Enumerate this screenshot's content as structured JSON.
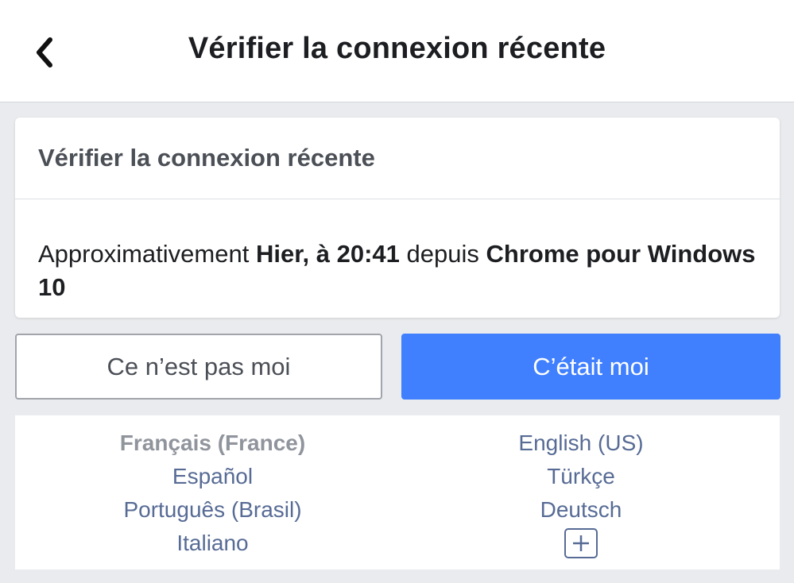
{
  "header": {
    "title": "Vérifier la connexion récente",
    "back_icon": "chevron-left-icon"
  },
  "card": {
    "title": "Vérifier la connexion récente",
    "message": {
      "prefix": "Approximativement ",
      "time": "Hier, à 20:41",
      "middle": " depuis ",
      "device": "Chrome pour Windows 10"
    }
  },
  "actions": {
    "not_me": "Ce n’est pas moi",
    "was_me": "C’était moi"
  },
  "languages": {
    "left": [
      "Français (France)",
      "Español",
      "Português (Brasil)",
      "Italiano"
    ],
    "right": [
      "English (US)",
      "Türkçe",
      "Deutsch"
    ],
    "current": "Français (France)",
    "more_icon": "plus-icon"
  },
  "colors": {
    "primary": "#4080ff",
    "link": "#576b95",
    "background": "#e9ebee"
  }
}
